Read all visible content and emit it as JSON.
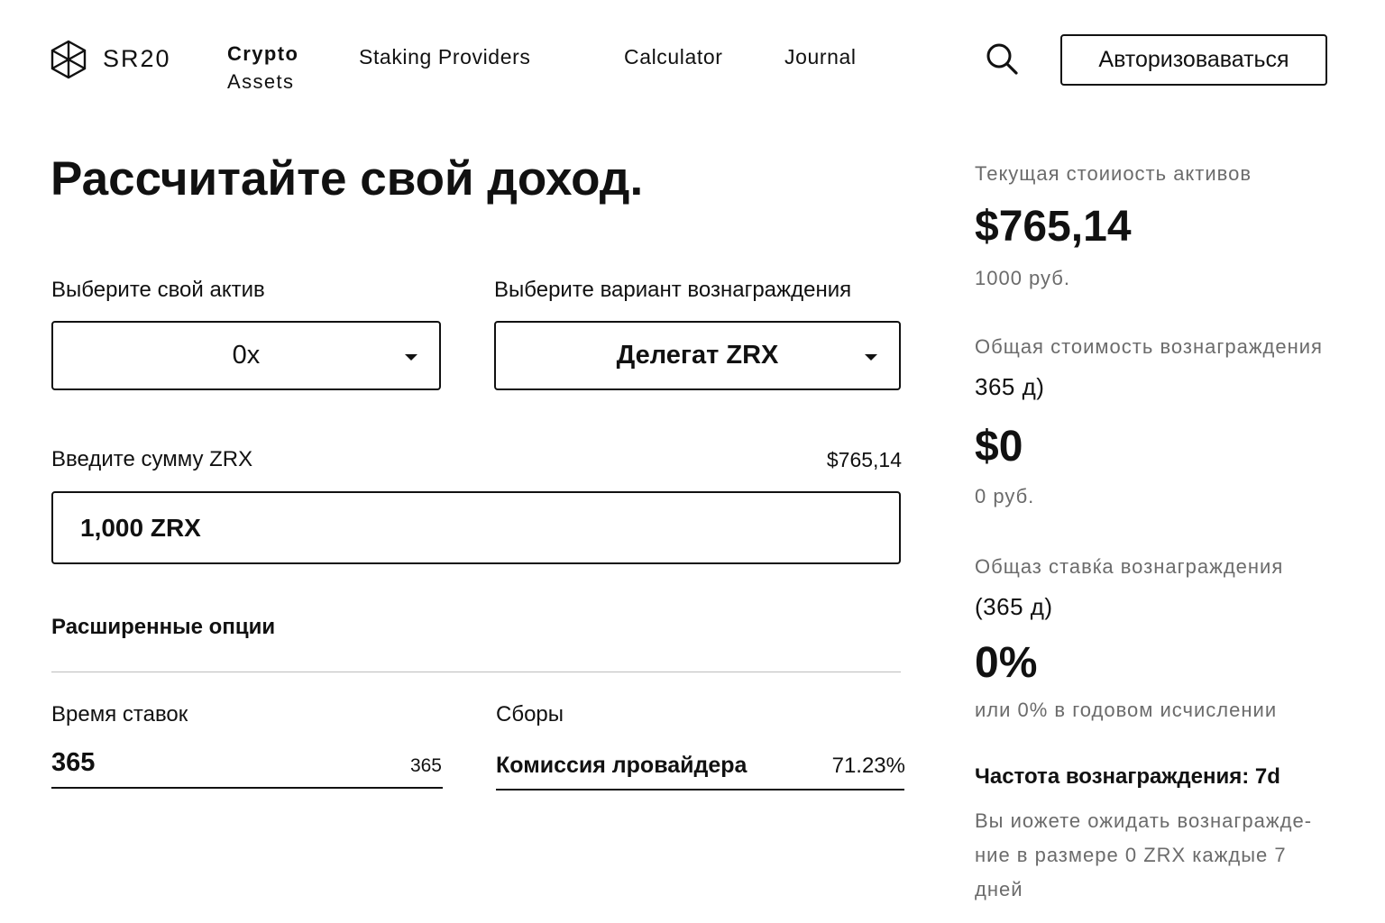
{
  "header": {
    "logo_text": "SR20",
    "nav": {
      "crypto_line1": "Crypto",
      "crypto_line2": "Assets",
      "staking": "Staking Providers",
      "calculator": "Calculator",
      "journal": "Journal"
    },
    "login_label": "Авторизоваваться",
    "icons": {
      "logo": "cube-outline-icon",
      "search": "search-icon"
    }
  },
  "calculator": {
    "title": "Рассчитайте свой доход.",
    "asset_label": "Выберите свой актив",
    "asset_value": "0x",
    "reward_label": "Выберите вариант вознаграждения",
    "reward_value": "Делегат ZRX",
    "amount_label": "Введите сумму ZRX",
    "amount_usd": "$765,14",
    "amount_value": "1,000 ZRX",
    "advanced_title": "Расширенные опции",
    "staking_time_label": "Время ставок",
    "staking_time_value": "365",
    "staking_time_max": "365",
    "fees_label": "Сборы",
    "provider_fee_label": "Комиссия лровайдера",
    "provider_fee_value": "71.23%"
  },
  "summary": {
    "current_label": "Текущая стоииость активов",
    "current_value": "$765,14",
    "current_rub": "1000 руб.",
    "total_reward_label": "Общая стоимость вознаграждения",
    "total_reward_period": "365 д)",
    "total_reward_value": "$0",
    "total_reward_rub": "0 руб.",
    "rate_label": "Общаз ставќа вознаграждения",
    "rate_period": "(365 д)",
    "rate_value": "0%",
    "rate_annual": "или 0% в годовом исчислении",
    "frequency_title": "Частота вознаграждения: 7d",
    "frequency_desc_1": "Вы иожете ожидать вознагражде-",
    "frequency_desc_2": "ние в размере 0 ZRX каждые 7",
    "frequency_desc_3": "дней"
  },
  "colors": {
    "text": "#111111",
    "muted": "#6b6b6b",
    "divider": "#bdbdbd",
    "background": "#ffffff"
  }
}
